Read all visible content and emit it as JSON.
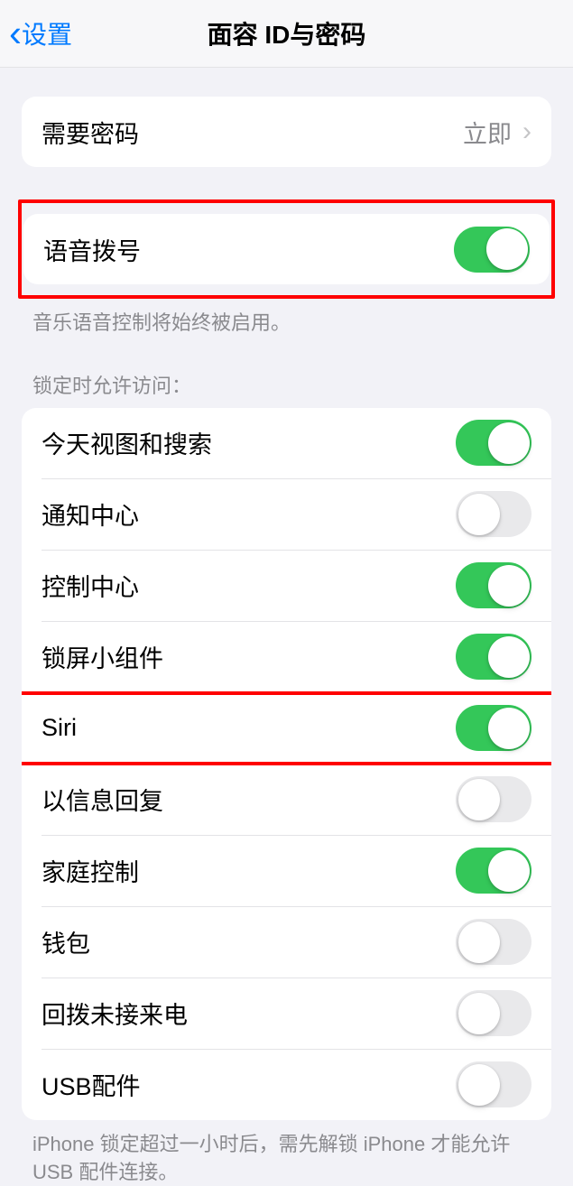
{
  "nav": {
    "back_label": "设置",
    "title": "面容 ID与密码"
  },
  "passcode_group": {
    "require_passcode_label": "需要密码",
    "require_passcode_value": "立即"
  },
  "voice_dial": {
    "label": "语音拨号",
    "on": true,
    "footer": "音乐语音控制将始终被启用。"
  },
  "lock_access": {
    "header": "锁定时允许访问：",
    "items": [
      {
        "label": "今天视图和搜索",
        "on": true
      },
      {
        "label": "通知中心",
        "on": false
      },
      {
        "label": "控制中心",
        "on": true
      },
      {
        "label": "锁屏小组件",
        "on": true
      },
      {
        "label": "Siri",
        "on": true
      },
      {
        "label": "以信息回复",
        "on": false
      },
      {
        "label": "家庭控制",
        "on": true
      },
      {
        "label": "钱包",
        "on": false
      },
      {
        "label": "回拨未接来电",
        "on": false
      },
      {
        "label": "USB配件",
        "on": false
      }
    ],
    "footer": "iPhone 锁定超过一小时后，需先解锁 iPhone 才能允许USB 配件连接。"
  }
}
